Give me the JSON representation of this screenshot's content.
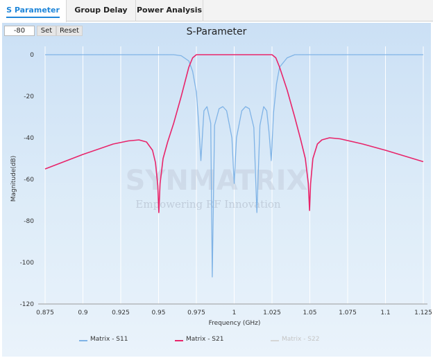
{
  "tabs": [
    {
      "label": "S Parameter",
      "active": true
    },
    {
      "label": "Group Delay",
      "active": false
    },
    {
      "label": "Power Analysis",
      "active": false
    }
  ],
  "controls": {
    "threshold_value": "-80",
    "set_label": "Set",
    "reset_label": "Reset"
  },
  "watermark": {
    "brand": "SYNMATRIX",
    "tagline": "Empowering RF Innovation"
  },
  "chart_data": {
    "type": "line",
    "title": "S-Parameter",
    "xlabel": "Frequency (GHz)",
    "ylabel": "Magnitude(dB)",
    "xlim": [
      0.875,
      1.125
    ],
    "ylim": [
      -120,
      0
    ],
    "x_ticks": [
      "0.875",
      "0.9",
      "0.925",
      "0.95",
      "0.975",
      "1",
      "1.025",
      "1.05",
      "1.075",
      "1.1",
      "1.125"
    ],
    "y_ticks": [
      "0",
      "-20",
      "-40",
      "-60",
      "-80",
      "-100",
      "-120"
    ],
    "grid": "vertical",
    "legend_position": "bottom",
    "series": [
      {
        "name": "Matrix - S11",
        "color": "#7fb3e6",
        "visible": true,
        "x": [
          0.875,
          0.96,
          0.965,
          0.97,
          0.9725,
          0.975,
          0.9765,
          0.978,
          0.98,
          0.982,
          0.9845,
          0.9855,
          0.987,
          0.99,
          0.9925,
          0.995,
          0.9985,
          1.0,
          1.0015,
          1.005,
          1.0075,
          1.01,
          1.013,
          1.015,
          1.017,
          1.0195,
          1.0215,
          1.023,
          1.0245,
          1.026,
          1.028,
          1.03,
          1.035,
          1.04,
          1.125
        ],
        "y": [
          0,
          0,
          -0.5,
          -3,
          -8,
          -18,
          -33,
          -51,
          -27,
          -25,
          -33,
          -107,
          -34,
          -26,
          -25,
          -27,
          -40,
          -62,
          -40,
          -27,
          -25,
          -26,
          -35,
          -76,
          -34,
          -25,
          -27,
          -37,
          -51,
          -28,
          -14,
          -6,
          -1.5,
          0,
          0
        ]
      },
      {
        "name": "Matrix - S21",
        "color": "#e8246a",
        "visible": true,
        "x": [
          0.875,
          0.9,
          0.92,
          0.93,
          0.937,
          0.942,
          0.946,
          0.948,
          0.9495,
          0.9502,
          0.951,
          0.953,
          0.956,
          0.96,
          0.965,
          0.97,
          0.9725,
          0.975,
          0.98,
          0.99,
          1.0,
          1.01,
          1.02,
          1.025,
          1.0275,
          1.03,
          1.035,
          1.04,
          1.044,
          1.047,
          1.049,
          1.0498,
          1.0505,
          1.052,
          1.055,
          1.058,
          1.063,
          1.07,
          1.085,
          1.1,
          1.125
        ],
        "y": [
          -55,
          -48,
          -43,
          -41.5,
          -41,
          -42,
          -46,
          -52,
          -63,
          -76,
          -62,
          -50,
          -42,
          -33,
          -20,
          -6,
          -1.5,
          0,
          0,
          0,
          0,
          0,
          0,
          0,
          -1.5,
          -6,
          -17,
          -30,
          -41,
          -50,
          -62,
          -75,
          -62,
          -50,
          -43,
          -41,
          -40,
          -40.5,
          -43,
          -46,
          -51.5
        ]
      },
      {
        "name": "Matrix - S22",
        "color": "#bfbfbf",
        "visible": false,
        "x": [],
        "y": []
      }
    ]
  }
}
